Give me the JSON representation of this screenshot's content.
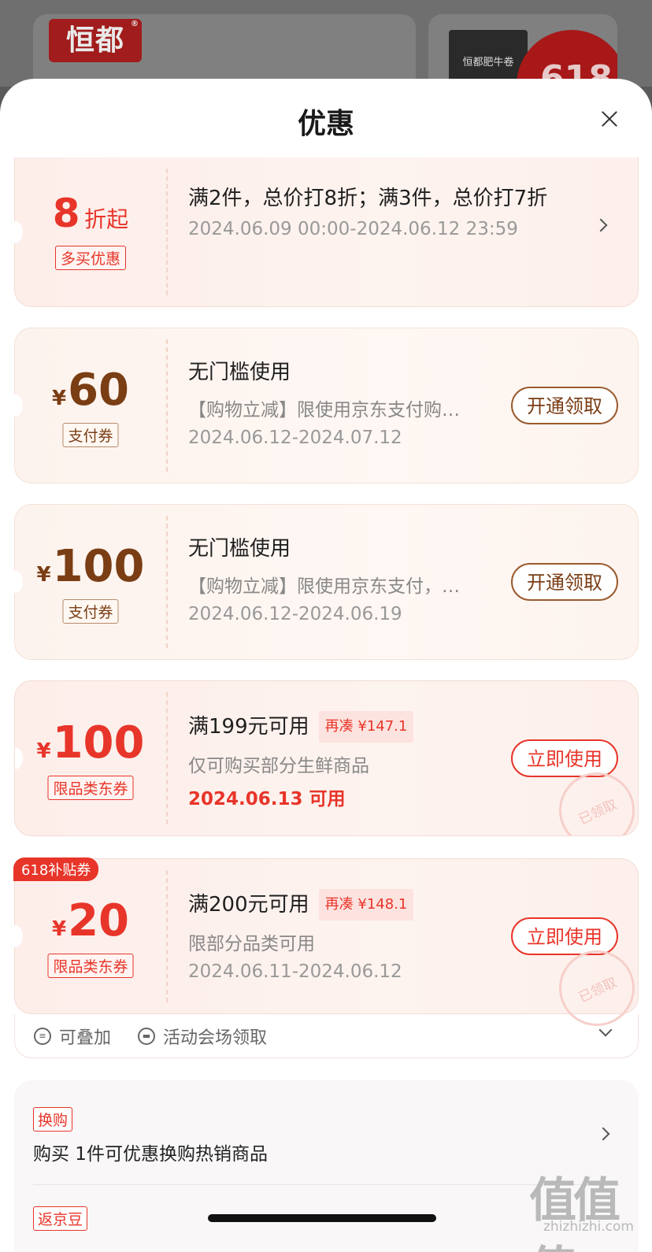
{
  "background": {
    "logo_text": "恒都",
    "logo_mark": "®",
    "product_label": "恒都肥牛卷",
    "promo_badge": "618"
  },
  "sheet": {
    "title": "优惠"
  },
  "coupons": [
    {
      "amount": "8",
      "unit": "折起",
      "tag": "多买优惠",
      "title": "满2件，总价打8折；满3件，总价打7折",
      "dates": "2024.06.09 00:00-2024.06.12 23:59"
    },
    {
      "currency": "¥",
      "amount": "60",
      "tag": "支付券",
      "title": "无门槛使用",
      "desc": "【购物立减】限使用京东支付购…",
      "dates": "2024.06.12-2024.07.12",
      "button": "开通领取"
    },
    {
      "currency": "¥",
      "amount": "100",
      "tag": "支付券",
      "title": "无门槛使用",
      "desc": "【购物立减】限使用京东支付，…",
      "dates": "2024.06.12-2024.06.19",
      "button": "开通领取"
    },
    {
      "currency": "¥",
      "amount": "100",
      "tag": "限品类东券",
      "title": "满199元可用",
      "pill": "再凑 ¥147.1",
      "desc": "仅可购买部分生鲜商品",
      "dates": "2024.06.13 可用",
      "button": "立即使用",
      "stamp": "已领取"
    },
    {
      "corner": "618补贴券",
      "currency": "¥",
      "amount": "20",
      "tag": "限品类东券",
      "title": "满200元可用",
      "pill": "再凑 ¥148.1",
      "desc": "限部分品类可用",
      "dates": "2024.06.11-2024.06.12",
      "button": "立即使用",
      "stamp": "已领取"
    }
  ],
  "footer": {
    "stackable": "可叠加",
    "venue": "活动会场领取"
  },
  "promos": [
    {
      "tag": "换购",
      "text": "购买 1件可优惠换购热销商品"
    },
    {
      "tag": "返京豆"
    }
  ],
  "watermark": {
    "logo": "值值值",
    "url": "zhizhizhi.com"
  },
  "colors": {
    "accent_red": "#e8352a",
    "brown": "#7a3d14"
  }
}
